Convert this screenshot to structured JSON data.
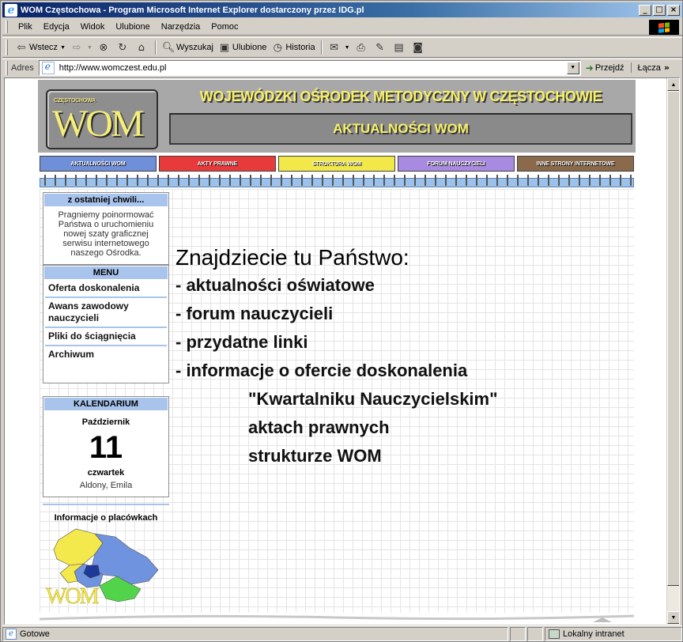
{
  "window": {
    "title": "WOM Częstochowa - Program Microsoft Internet Explorer dostarczony przez IDG.pl",
    "controls": {
      "minimize": "_",
      "maximize": "□",
      "close": "×"
    }
  },
  "menubar": [
    "Plik",
    "Edycja",
    "Widok",
    "Ulubione",
    "Narzędzia",
    "Pomoc"
  ],
  "toolbar": {
    "back": "Wstecz",
    "search": "Wyszukaj",
    "favorites": "Ulubione",
    "history": "Historia"
  },
  "address": {
    "label": "Adres",
    "url": "http://www.womczest.edu.pl",
    "go": "Przejdź",
    "links": "Łącza",
    "links_more": "»"
  },
  "site": {
    "logo_small": "CZĘSTOCHOWA",
    "logo_big": "WOM",
    "title": "WOJEWÓDZKI OŚRODEK METODYCZNY W CZĘSTOCHOWIE",
    "subtitle": "AKTUALNOŚCI  WOM",
    "nav": [
      {
        "label": "AKTUALNOŚCI  WOM",
        "color": "#6f8fd8"
      },
      {
        "label": "AKTY  PRAWNE",
        "color": "#e83a3a"
      },
      {
        "label": "STRUKTURA  WOM",
        "color": "#f2e84a"
      },
      {
        "label": "FORUM  NAUCZYCIELI",
        "color": "#a88ae0"
      },
      {
        "label": "INNE STRONY INTERNETOWE",
        "color": "#8a6a4a"
      }
    ],
    "news": {
      "heading": "z ostatniej chwili...",
      "text": "Pragniemy poinormować Państwa o uruchomieniu nowej szaty graficznej serwisu internetowego naszego Ośrodka."
    },
    "menu": {
      "heading": "MENU",
      "items": [
        "Oferta doskonalenia",
        "Awans zawodowy nauczycieli",
        "Pliki do ściągnięcia",
        "Archiwum"
      ]
    },
    "calendar": {
      "heading": "KALENDARIUM",
      "month": "Październik",
      "day": "11",
      "weekday": "czwartek",
      "names": "Aldony, Emila"
    },
    "placowki": {
      "heading": "Informacje o placówkach",
      "map_logo": "WOM"
    },
    "main": {
      "headline": "Znajdziecie tu Państwo:",
      "items": [
        "- aktualności oświatowe",
        "- forum nauczycieli",
        "- przydatne linki",
        "- informacje o ofercie doskonalenia"
      ],
      "subitems": [
        "\"Kwartalniku Nauczycielskim\"",
        "aktach prawnych",
        "strukturze WOM"
      ]
    }
  },
  "status": {
    "text": "Gotowe",
    "zone": "Lokalny intranet"
  }
}
